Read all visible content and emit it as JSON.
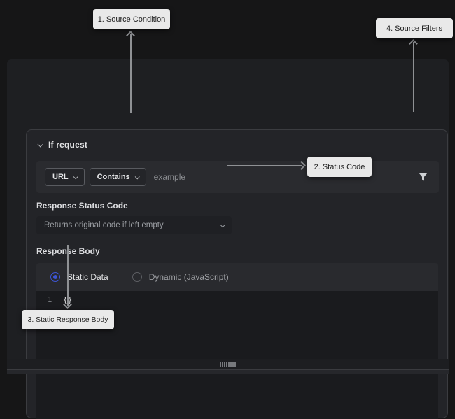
{
  "annotations": {
    "label1": "1. Source Condition",
    "label2": "2. Status Code",
    "label3": "3. Static Response Body",
    "label4": "4. Source Filters"
  },
  "rule_panel": {
    "header": "If request",
    "condition": {
      "key_selector": "URL",
      "operator_selector": "Contains",
      "value_placeholder": "example"
    },
    "status_code": {
      "label": "Response Status Code",
      "placeholder": "Returns original code if left empty"
    },
    "response_body": {
      "label": "Response Body",
      "radio_static": "Static Data",
      "radio_dynamic": "Dynamic (JavaScript)",
      "selected_option": "Static Data",
      "editor": {
        "line_number": "1",
        "code": "{}"
      }
    }
  },
  "icons": {
    "collapse": "chevron-down-icon",
    "selector": "chevron-down-icon",
    "filter": "filter-funnel-icon",
    "resize": "drag-handle-dots"
  },
  "colors": {
    "accent_blue": "#3d55d4",
    "annotation_bg": "#e9e9e9",
    "arrow": "#8f9194",
    "card_bg": "#232428",
    "editor_bg": "#1a1b1e"
  }
}
